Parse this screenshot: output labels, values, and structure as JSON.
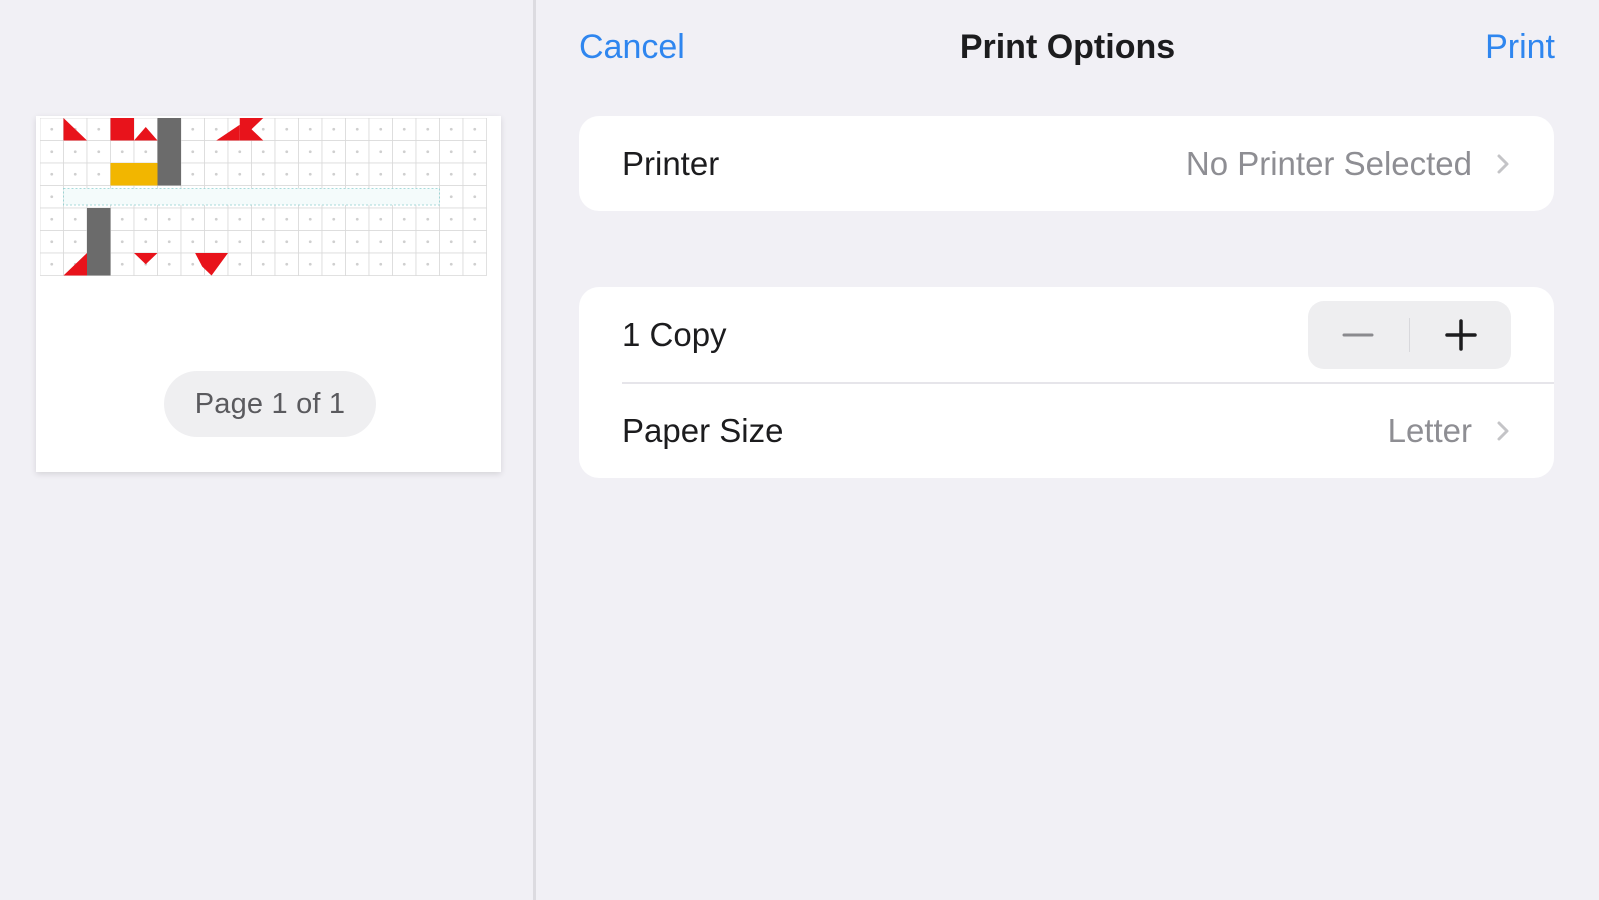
{
  "nav": {
    "cancel_label": "Cancel",
    "title": "Print Options",
    "print_label": "Print"
  },
  "preview": {
    "page_indicator": "Page 1 of 1"
  },
  "printer_row": {
    "label": "Printer",
    "value": "No Printer Selected"
  },
  "copies_row": {
    "label": "1 Copy",
    "count": 1,
    "decrement_icon": "minus-icon",
    "increment_icon": "plus-icon"
  },
  "paper_row": {
    "label": "Paper Size",
    "value": "Letter"
  },
  "colors": {
    "accent": "#2f86ef",
    "background": "#f1f0f5",
    "card": "#ffffff",
    "secondary_text": "#8e8e93",
    "thumb_red": "#e8131b",
    "thumb_yellow": "#f2b600",
    "thumb_gray": "#6b6b6b"
  }
}
